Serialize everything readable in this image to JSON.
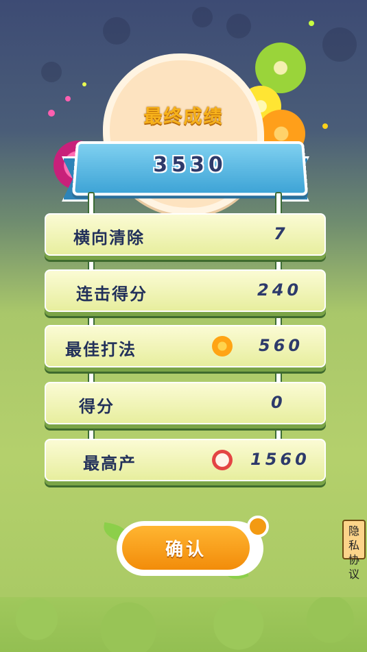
{
  "title": "最终成绩",
  "total_score": "3530",
  "rows": [
    {
      "label": "横向清除",
      "value": "7",
      "icon": ""
    },
    {
      "label": "连击得分",
      "value": "240",
      "icon": ""
    },
    {
      "label": "最佳打法",
      "value": "560",
      "icon": "orange-slice-icon"
    },
    {
      "label": "得分",
      "value": "0",
      "icon": ""
    },
    {
      "label": "最高产",
      "value": "1560",
      "icon": "apple-slice-icon"
    }
  ],
  "confirm_label": "确认",
  "privacy_label": "隐私协议",
  "colors": {
    "accent": "#f7a41b",
    "ribbon": "#4fb4e2",
    "text": "#2d3a6b",
    "row_bg": "#f4f6c0"
  }
}
